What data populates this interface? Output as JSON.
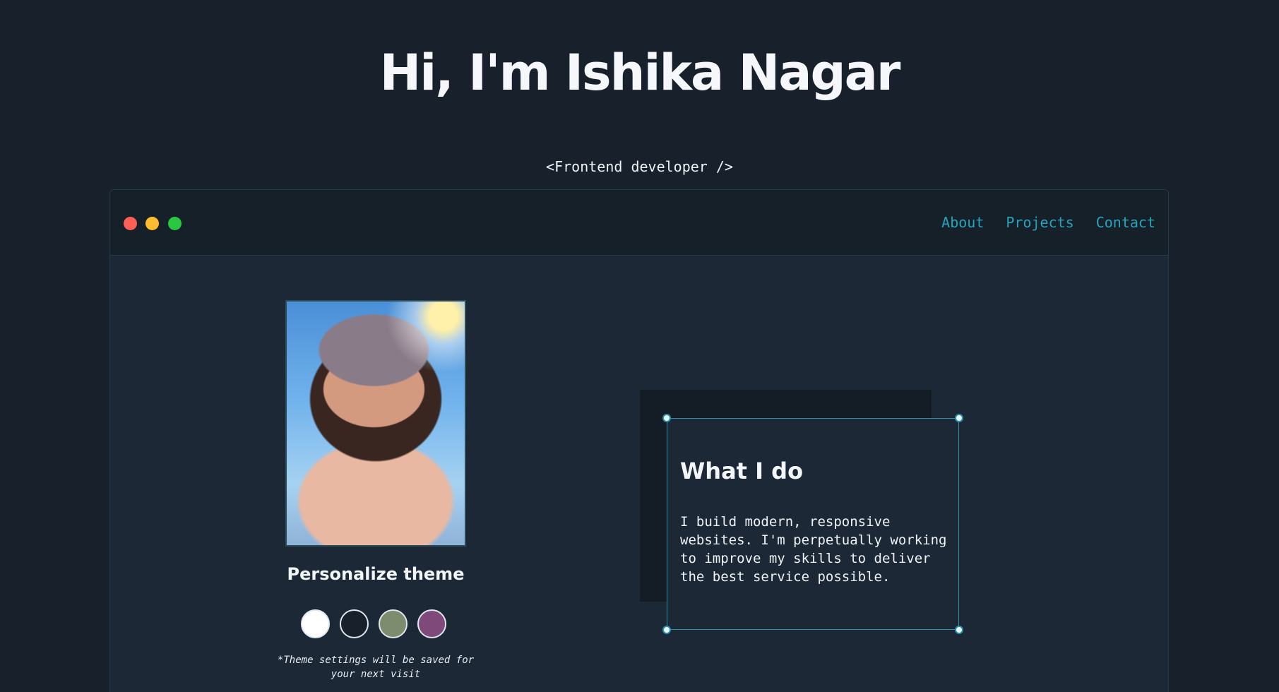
{
  "hero": {
    "title": "Hi, I'm Ishika Nagar",
    "subtitle": "<Frontend developer />"
  },
  "window": {
    "nav": [
      "About",
      "Projects",
      "Contact"
    ]
  },
  "profile": {
    "theme_title": "Personalize theme",
    "swatches": [
      {
        "name": "light",
        "color": "#ffffff"
      },
      {
        "name": "dark",
        "color": "#17202b"
      },
      {
        "name": "green",
        "color": "#7d8b6e"
      },
      {
        "name": "purple",
        "color": "#7f4a7a"
      }
    ],
    "theme_note": "*Theme settings will be saved for your next visit"
  },
  "card": {
    "title": "What I do",
    "text": "I build modern, responsive websites. I'm perpetually working to improve my skills to deliver the best service possible."
  },
  "colors": {
    "background": "#17202b",
    "accent": "#27a3bd"
  }
}
